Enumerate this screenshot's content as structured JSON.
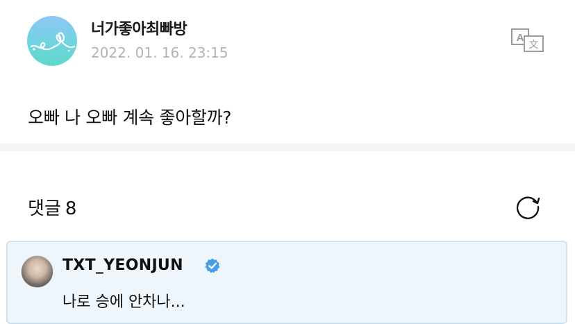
{
  "post": {
    "author": "너가좋아최빠방",
    "date": "2022. 01. 16. 23:15",
    "body": "오빠 나 오빠 계속 좋아할까?"
  },
  "comments": {
    "label": "댓글",
    "count": "8"
  },
  "comment": {
    "author": "TXT_YEONJUN",
    "text": "나로 승에 안차나..."
  },
  "icons": {
    "translate": "translate-icon",
    "refresh": "refresh-icon",
    "verified": "verified-badge-icon"
  },
  "colors": {
    "accent_blue": "#4a9be8",
    "comment_bg": "#eef6fc",
    "date_gray": "#b3b3b3"
  }
}
